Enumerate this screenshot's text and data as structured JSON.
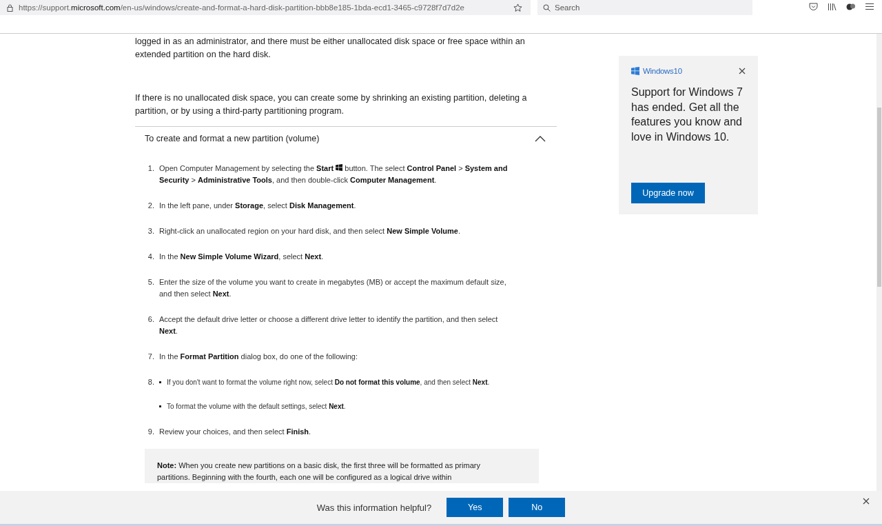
{
  "browser": {
    "url_prefix": "https://support.",
    "url_domain": "microsoft.com",
    "url_rest": "/en-us/windows/create-and-format-a-hard-disk-partition-bbb8e185-1bda-ecd1-3465-c9728f7d7d2e",
    "search_placeholder": "Search"
  },
  "intro": [
    "logged in as an administrator, and there must be either unallocated disk space or free space within an extended partition on the hard disk.",
    "If there is no unallocated disk space, you can create some by shrinking an existing partition, deleting a partition, or by using a third-party partitioning program."
  ],
  "section": {
    "title": "To create and format a new partition (volume)",
    "expanded": true,
    "steps": [
      {
        "number": "1.",
        "text": "Open Computer Management by selecting the **Start**",
        "after_icon": "button. The select **Control Panel** > **System and Security** > **Administrative Tools**, and then double-click **Computer Management**."
      },
      {
        "number": "2.",
        "text": "In the left pane, under **Storage**, select **Disk Management**."
      },
      {
        "number": "3.",
        "text": "Right-click an unallocated region on your hard disk, and then select **New Simple Volume**."
      },
      {
        "number": "4.",
        "text": "In the **New Simple Volume Wizard**, select **Next**."
      },
      {
        "number": "5.",
        "text": "Enter the size of the volume you want to create in megabytes (MB) or accept the maximum default size, and then select **Next**."
      },
      {
        "number": "6.",
        "text": "Accept the default drive letter or choose a different drive letter to identify the partition, and then select **Next**."
      },
      {
        "number": "7.",
        "text": "In the **Format Partition** dialog box, do one of the following:"
      },
      {
        "number": "8.",
        "bullets": [
          "If you don't want to format the volume right now, select **Do not format this volume**, and then select **Next**.",
          "To format the volume with the default settings, select **Next**."
        ]
      },
      {
        "number": "9.",
        "text": "Review your choices, and then select **Finish**."
      }
    ],
    "note": "**Note:** When you create new partitions on a basic disk, the first three will be formatted as primary partitions. Beginning with the fourth, each one will be configured as a logical drive within"
  },
  "promo": {
    "brand": "Windows10",
    "message": "Support for Windows 7 has ended. Get all the features you know and love in Windows 10.",
    "button": "Upgrade now"
  },
  "feedback": {
    "question": "Was this information helpful?",
    "buttons": [
      "Yes",
      "No"
    ]
  }
}
